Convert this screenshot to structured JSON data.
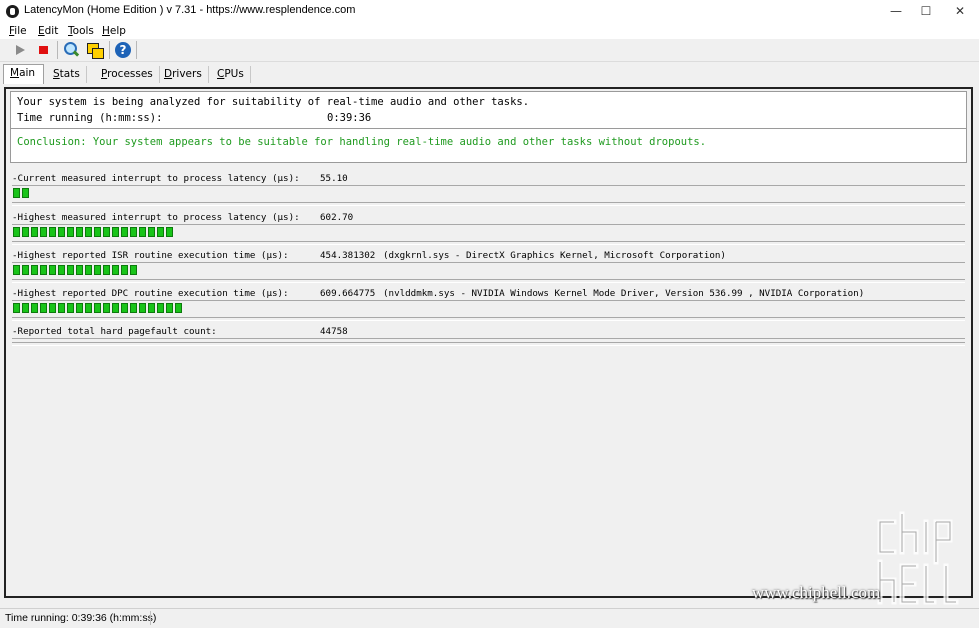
{
  "window": {
    "title": "LatencyMon  (Home Edition )  v 7.31 - https://www.resplendence.com",
    "min_glyph": "—",
    "max_glyph": "☐",
    "close_glyph": "✕"
  },
  "menu": {
    "items": [
      {
        "accel": "F",
        "rest": "ile"
      },
      {
        "accel": "E",
        "rest": "dit"
      },
      {
        "accel": "T",
        "rest": "ools"
      },
      {
        "accel": "H",
        "rest": "elp"
      }
    ]
  },
  "toolbar": {
    "icons": [
      "play-icon",
      "stop-icon",
      "search-icon",
      "windows-icon",
      "help-icon"
    ]
  },
  "tabs": [
    {
      "accel": "M",
      "rest": "ain",
      "active": true
    },
    {
      "accel": "S",
      "rest": "tats"
    },
    {
      "accel": "P",
      "rest": "rocesses"
    },
    {
      "accel": "D",
      "rest": "rivers"
    },
    {
      "accel": "C",
      "rest": "PUs"
    }
  ],
  "status": {
    "analysis": "Your system is being analyzed for suitability of real-time audio and other tasks.",
    "time_label": "Time running (h:mm:ss):",
    "time_value": "0:39:36",
    "conclusion": "Conclusion: Your system appears to be suitable for handling real-time audio and other tasks without dropouts.",
    "conclusion_color": "#1f9a1f"
  },
  "metrics": [
    {
      "label": "-Current measured interrupt to process latency (µs):",
      "value": "55.10",
      "detail": "",
      "segments": 2
    },
    {
      "label": "-Highest measured interrupt to process latency (µs):",
      "value": "602.70",
      "detail": "",
      "segments": 18
    },
    {
      "label": "-Highest reported ISR routine execution time (µs):",
      "value": "454.381302",
      "detail": "(dxgkrnl.sys - DirectX Graphics Kernel, Microsoft Corporation)",
      "segments": 14
    },
    {
      "label": "-Highest reported DPC routine execution time (µs):",
      "value": "609.664775",
      "detail": "(nvlddmkm.sys - NVIDIA Windows Kernel Mode Driver, Version 536.99 , NVIDIA Corporation)",
      "segments": 19
    },
    {
      "label": "-Reported total hard pagefault count:",
      "value": "44758",
      "detail": "",
      "segments": 0
    }
  ],
  "meter_color": "#19c419",
  "statusbar": {
    "text": "Time running: 0:39:36  (h:mm:ss)"
  },
  "watermark": {
    "url": "www.chiphell.com"
  }
}
